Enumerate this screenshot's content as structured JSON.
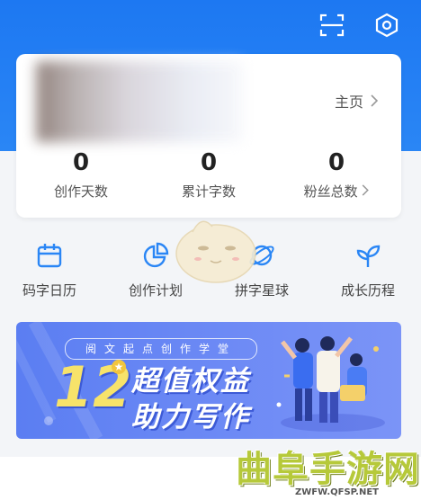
{
  "header": {
    "icons": [
      "scan-icon",
      "settings-hexagon-icon"
    ],
    "bg_color": "#1d78f2"
  },
  "profile_card": {
    "home_label": "主页",
    "stats": [
      {
        "value": "0",
        "label": "创作天数"
      },
      {
        "value": "0",
        "label": "累计字数"
      },
      {
        "value": "0",
        "label": "粉丝总数"
      }
    ]
  },
  "quick_nav": [
    {
      "label": "码字日历",
      "icon": "calendar-icon"
    },
    {
      "label": "创作计划",
      "icon": "pie-chart-icon"
    },
    {
      "label": "拼字星球",
      "icon": "planet-icon"
    },
    {
      "label": "成长历程",
      "icon": "sprout-icon"
    }
  ],
  "banner": {
    "subtitle": "阅文起点创作学堂",
    "number": "12",
    "line1": "超值权益",
    "line2": "助力写作"
  },
  "watermark": {
    "text": "曲阜手游网",
    "url": "ZWFW.QFSP.NET"
  },
  "colors": {
    "accent": "#2a86f5",
    "banner": "#6d8af5",
    "yellow": "#f7e36a"
  }
}
